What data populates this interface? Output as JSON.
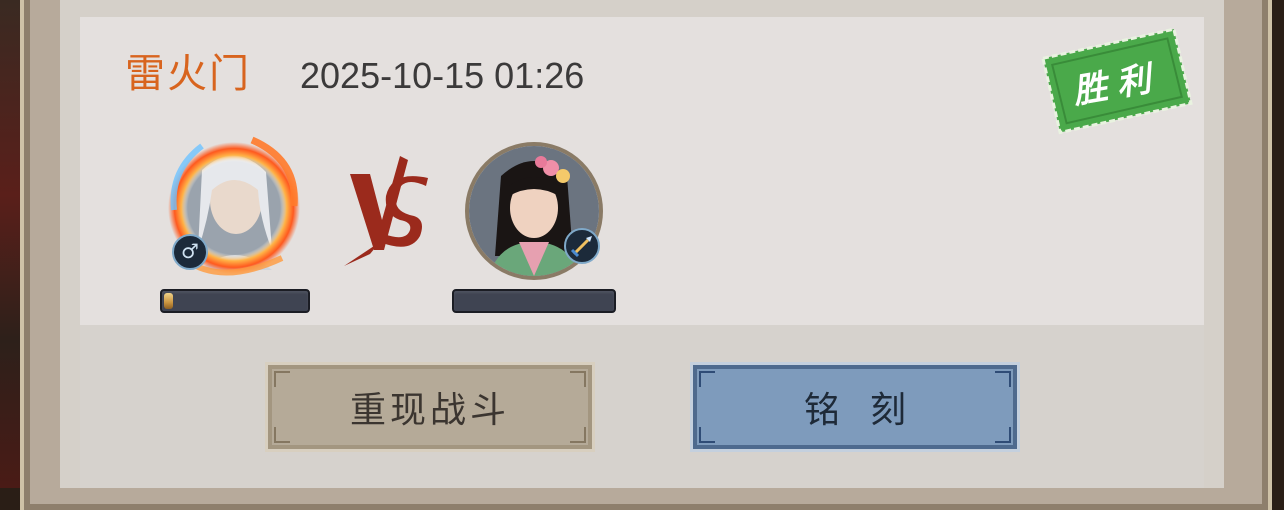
{
  "record": {
    "sect_name": "雷火门",
    "datetime": "2025-10-15 01:26",
    "result_stamp": "胜利"
  },
  "player": {
    "gender_icon": "♂",
    "hp_fraction": 0.06
  },
  "opponent": {
    "hp_fraction": 0
  },
  "vs_icon": "vs-icon",
  "buttons": {
    "replay_label": "重现战斗",
    "engrave_label": "铭刻"
  },
  "colors": {
    "sect_name": "#d8641e",
    "stamp_green": "#4aa94a",
    "vs_red": "#9b2a1c",
    "engrave_button": "#7e9bbc",
    "replay_button": "#b5aa98"
  }
}
